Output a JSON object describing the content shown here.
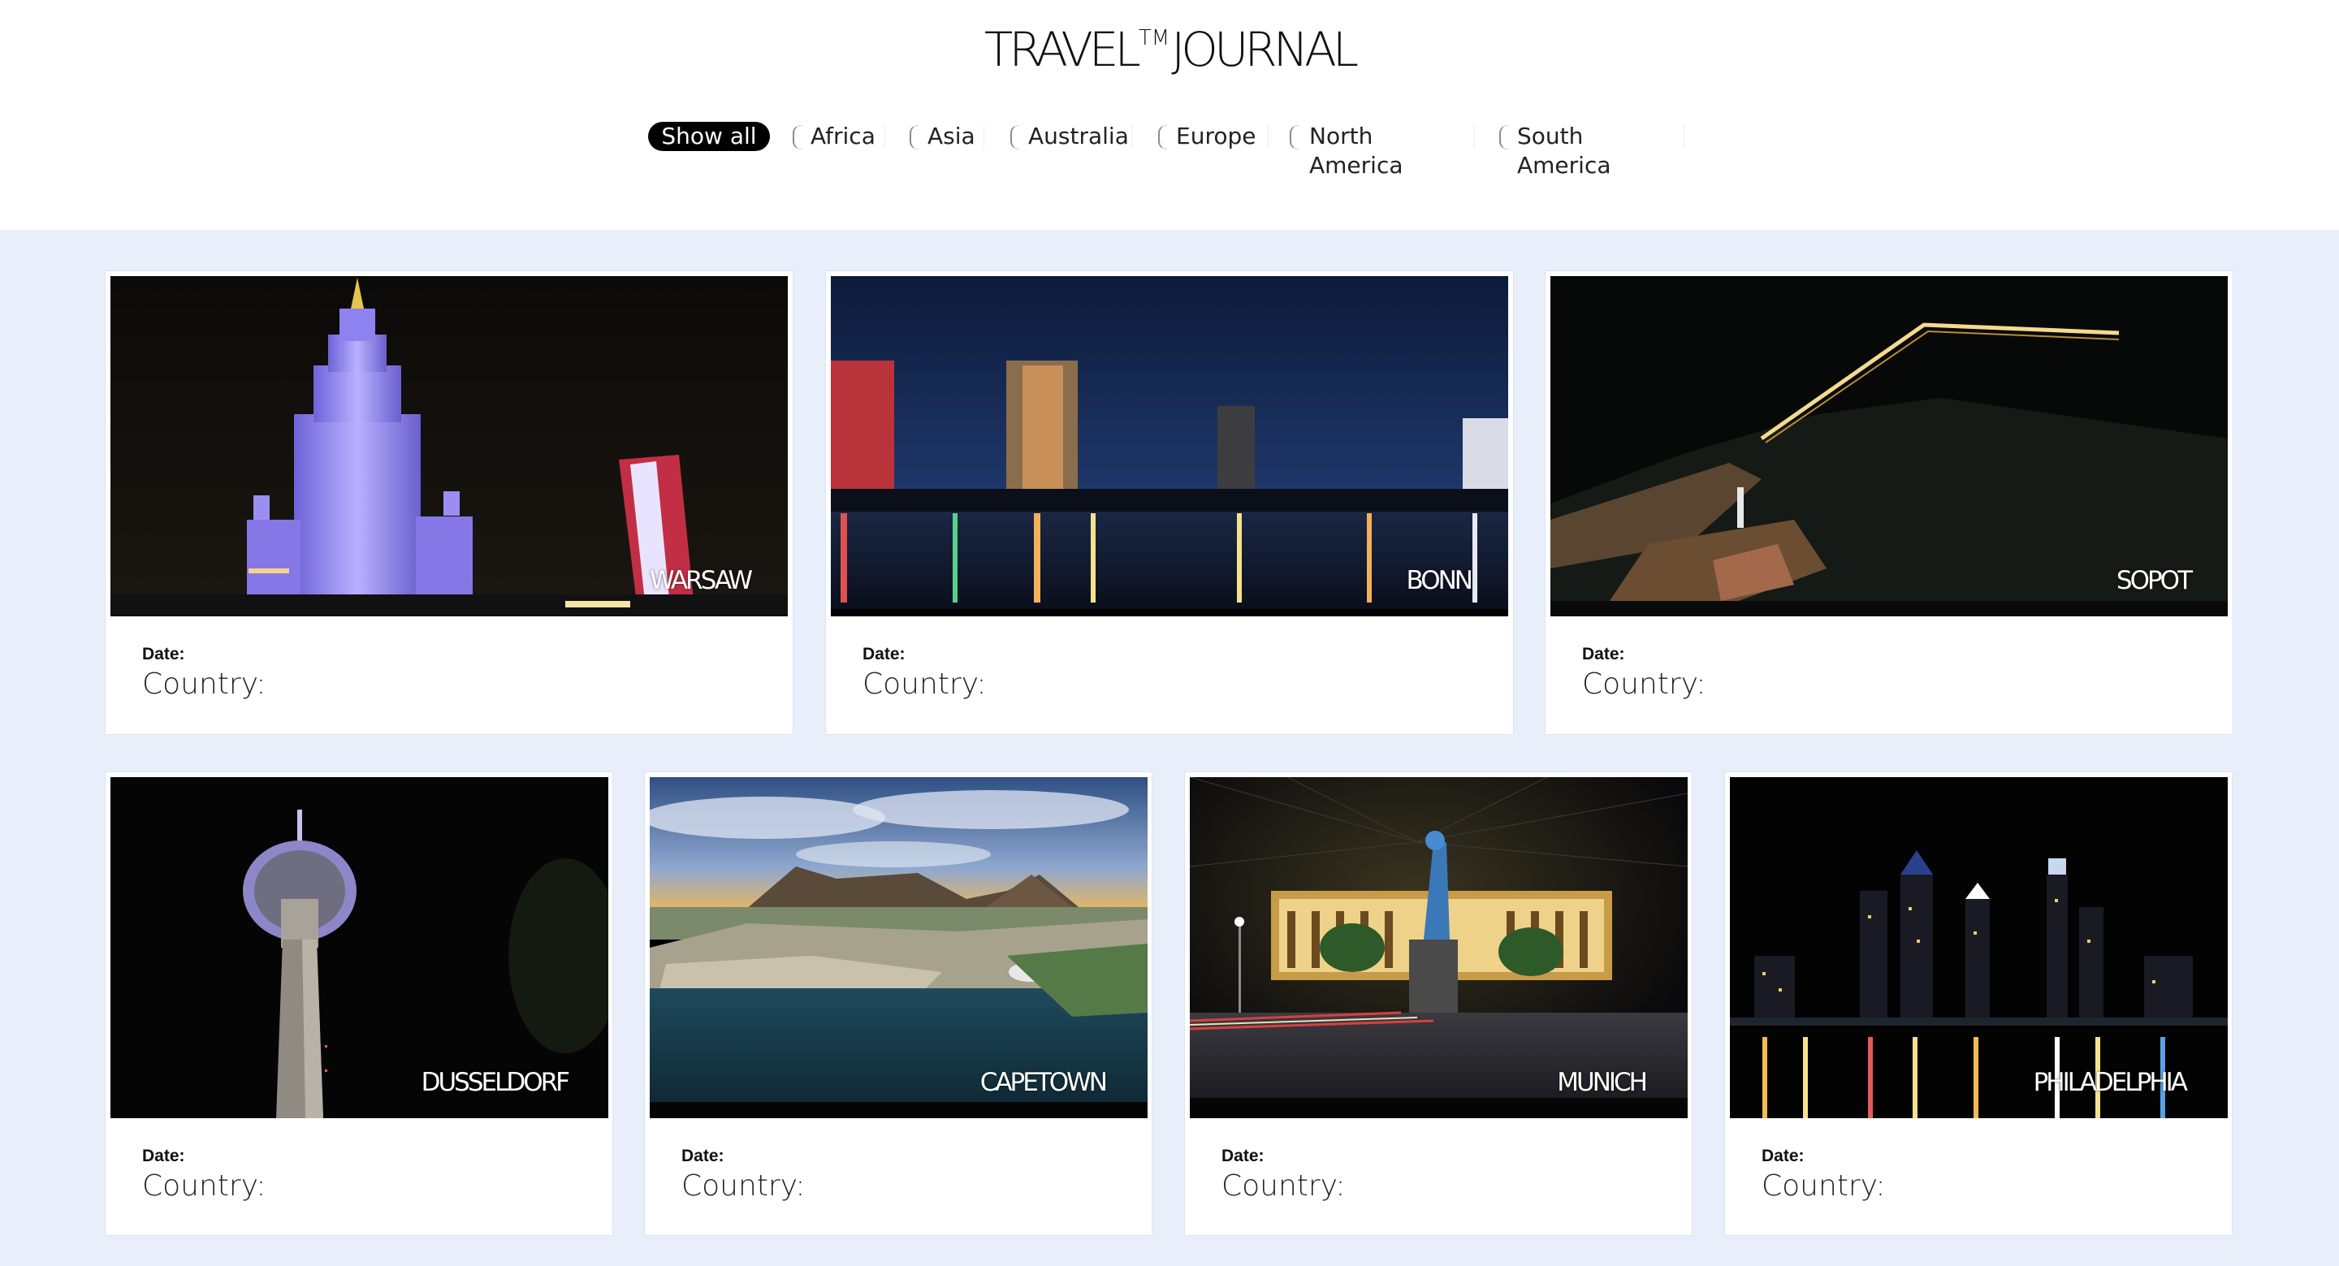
{
  "header": {
    "logo_left": "TRAVEL",
    "logo_tm": "TM",
    "logo_right": "JOURNAL"
  },
  "filters": [
    {
      "label": "Show all",
      "active": true
    },
    {
      "label": "Africa",
      "active": false
    },
    {
      "label": "Asia",
      "active": false
    },
    {
      "label": "Australia",
      "active": false
    },
    {
      "label": "Europe",
      "active": false
    },
    {
      "label": "North America",
      "active": false
    },
    {
      "label": "South America",
      "active": false
    }
  ],
  "cards": [
    {
      "city": "WARSAW",
      "date_label": "Date:",
      "country_label": "Country:"
    },
    {
      "city": "BONN",
      "date_label": "Date:",
      "country_label": "Country:"
    },
    {
      "city": "SOPOT",
      "date_label": "Date:",
      "country_label": "Country:"
    },
    {
      "city": "DUSSELDORF",
      "date_label": "Date:",
      "country_label": "Country:"
    },
    {
      "city": "CAPETOWN",
      "date_label": "Date:",
      "country_label": "Country:"
    },
    {
      "city": "MUNICH",
      "date_label": "Date:",
      "country_label": "Country:"
    },
    {
      "city": "PHILADELPHIA",
      "date_label": "Date:",
      "country_label": "Country:"
    }
  ],
  "colors": {
    "page_background": "#e9effa",
    "active_filter_background": "#000000",
    "card_background": "#ffffff"
  }
}
